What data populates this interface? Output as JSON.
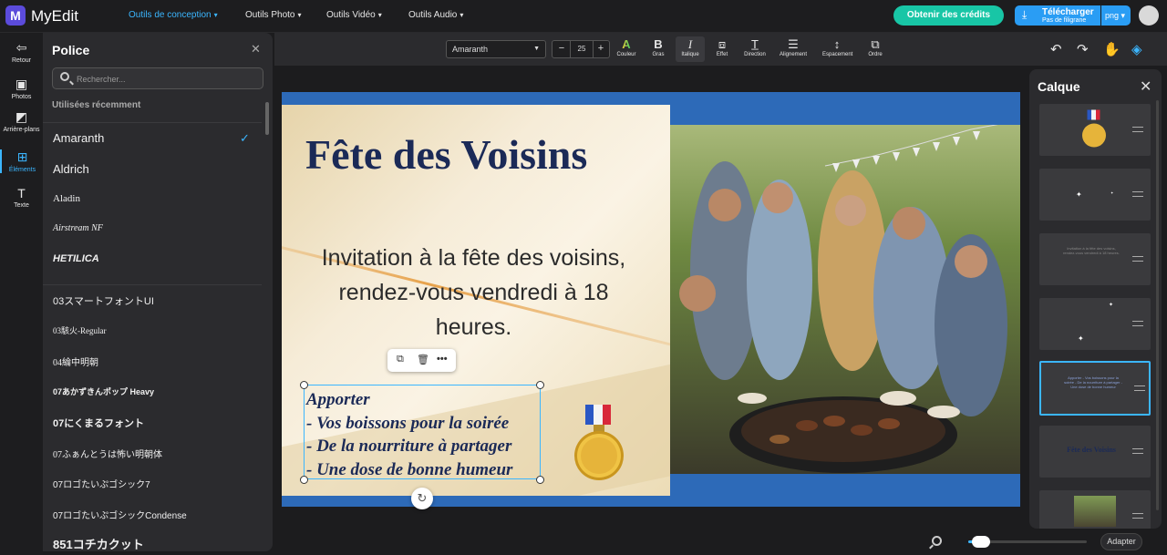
{
  "app": {
    "name": "MyEdit",
    "logo_letter": "M"
  },
  "topnav": [
    {
      "label": "Outils de conception",
      "active": true
    },
    {
      "label": "Outils Photo",
      "active": false
    },
    {
      "label": "Outils Vidéo",
      "active": false
    },
    {
      "label": "Outils Audio",
      "active": false
    }
  ],
  "header": {
    "credits_label": "Obtenir des crédits",
    "download_label": "Télécharger",
    "download_sub": "Pas de filigrane",
    "format": "png"
  },
  "leftrail": [
    {
      "label": "Retour",
      "icon": "back-icon"
    },
    {
      "label": "Photos",
      "icon": "image-icon"
    },
    {
      "label": "Arrière-plans",
      "icon": "background-icon"
    },
    {
      "label": "Éléments",
      "icon": "elements-icon",
      "active": true
    },
    {
      "label": "Texte",
      "icon": "text-icon"
    }
  ],
  "font_panel": {
    "title": "Police",
    "search_placeholder": "Rechercher...",
    "recent_label": "Utilisées récemment",
    "recent": [
      "Amaranth",
      "Aldrich",
      "Aladin",
      "Airstream NF",
      "HETILICA"
    ],
    "selected": "Amaranth",
    "all": [
      "03スマートフォントUI",
      "03駭火-Regular",
      "04綸中明朝",
      "07あかずきんポップ Heavy",
      "07にくまるフォント",
      "07ふぁんとうは怖い明朝体",
      "07ロゴたいぷゴシック7",
      "07ロゴたいぷゴシックCondense",
      "851コチカクット"
    ]
  },
  "toolbar": {
    "font_name": "Amaranth",
    "font_size": "25",
    "minus": "−",
    "plus": "+",
    "tools": [
      {
        "label": "Couleur",
        "icon": "color-icon"
      },
      {
        "label": "Gras",
        "icon": "bold-icon"
      },
      {
        "label": "Italique",
        "icon": "italic-icon",
        "active": true
      },
      {
        "label": "Effet",
        "icon": "effect-icon"
      },
      {
        "label": "Direction",
        "icon": "direction-icon"
      },
      {
        "label": "Alignement",
        "icon": "align-icon"
      },
      {
        "label": "Espacement",
        "icon": "spacing-icon"
      },
      {
        "label": "Ordre",
        "icon": "order-icon"
      }
    ]
  },
  "canvas": {
    "title": "Fête des Voisins",
    "invite": "Invitation à la fête des voisins, rendez-vous vendredi à 18 heures.",
    "list_lines": [
      "Apporter",
      "- Vos boissons pour la soirée",
      "- De la nourriture à partager",
      "- Une dose de bonne humeur"
    ]
  },
  "layers_panel": {
    "title": "Calque",
    "thumb_invite": "Invitation à la fête des voisins, rendez-vous vendredi à 18 heures.",
    "thumb_list": "Apporter - Vos boissons pour la soirée - De la nourriture à partager - Une dose de bonne humeur",
    "thumb_title": "Fête des Voisins"
  },
  "footer": {
    "adapter_label": "Adapter"
  },
  "colors": {
    "accent": "#3bb6ff",
    "credits": "#18c6a6",
    "download": "#2a9df4",
    "title_navy": "#1b2a57",
    "canvas_blue": "#2d6ab8"
  }
}
